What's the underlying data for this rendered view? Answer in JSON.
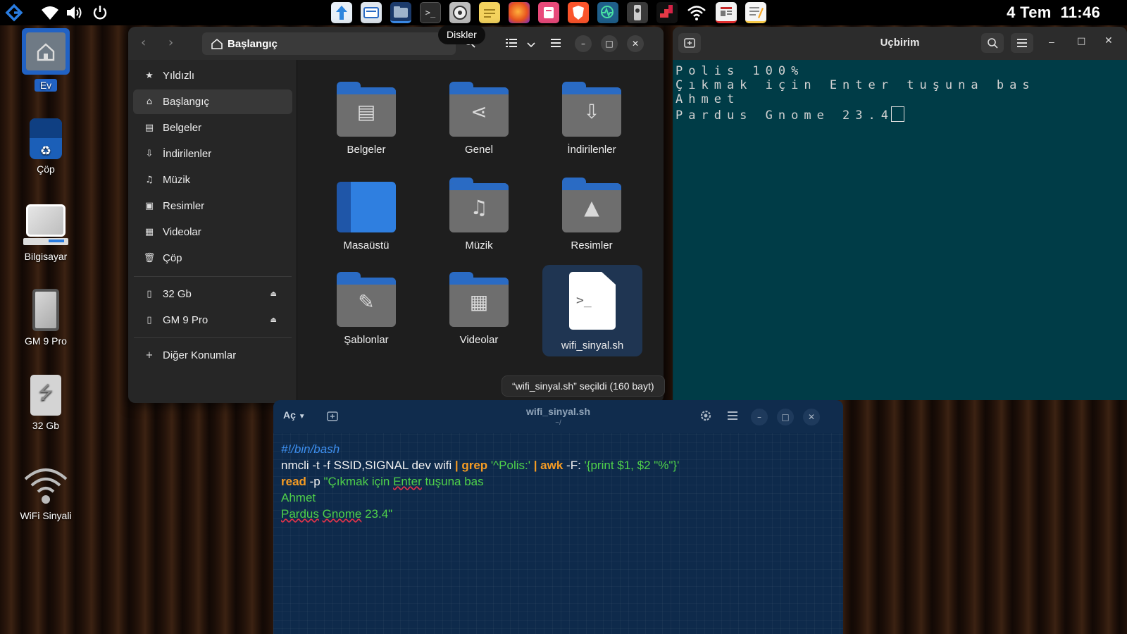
{
  "topbar": {
    "clock_date": "4 Tem",
    "clock_time": "11:46",
    "tooltip": "Diskler",
    "dock_apps": [
      "updater",
      "screenshot",
      "files",
      "terminal",
      "disks",
      "notes",
      "firefox",
      "flashcards",
      "brave",
      "system-monitor",
      "usb-writer",
      "tetris",
      "network",
      "news",
      "text-editor"
    ]
  },
  "desktop": {
    "items": [
      {
        "label": "Ev"
      },
      {
        "label": "Çöp"
      },
      {
        "label": "Bilgisayar"
      },
      {
        "label": "GM 9 Pro"
      },
      {
        "label": "32 Gb"
      },
      {
        "label": "WiFi Sinyali"
      }
    ]
  },
  "file_manager": {
    "path": "Başlangıç",
    "sidebar": [
      {
        "label": "Yıldızlı",
        "icon": "star-icon"
      },
      {
        "label": "Başlangıç",
        "icon": "home-icon"
      },
      {
        "label": "Belgeler",
        "icon": "document-icon"
      },
      {
        "label": "İndirilenler",
        "icon": "download-icon"
      },
      {
        "label": "Müzik",
        "icon": "music-icon"
      },
      {
        "label": "Resimler",
        "icon": "picture-icon"
      },
      {
        "label": "Videolar",
        "icon": "video-icon"
      },
      {
        "label": "Çöp",
        "icon": "trash-icon"
      }
    ],
    "devices": [
      {
        "label": "32 Gb",
        "icon": "usb-drive-icon"
      },
      {
        "label": "GM 9 Pro",
        "icon": "phone-icon"
      }
    ],
    "other_locations": "Diğer Konumlar",
    "items": [
      {
        "label": "Belgeler",
        "icon": "documents-folder-icon"
      },
      {
        "label": "Genel",
        "icon": "share-folder-icon"
      },
      {
        "label": "İndirilenler",
        "icon": "downloads-folder-icon"
      },
      {
        "label": "Masaüstü",
        "icon": "desktop-folder-icon"
      },
      {
        "label": "Müzik",
        "icon": "music-folder-icon"
      },
      {
        "label": "Resimler",
        "icon": "pictures-folder-icon"
      },
      {
        "label": "Şablonlar",
        "icon": "templates-folder-icon"
      },
      {
        "label": "Videolar",
        "icon": "videos-folder-icon"
      },
      {
        "label": "wifi_sinyal.sh",
        "icon": "script-file-icon"
      }
    ],
    "status": "“wifi_sinyal.sh” seçildi  (160 bayt)"
  },
  "terminal": {
    "title": "Uçbirim",
    "lines": [
      "Polis 100%",
      "Çıkmak için Enter tuşuna bas",
      "Ahmet",
      "Pardus Gnome 23.4"
    ]
  },
  "editor": {
    "open_label": "Aç",
    "title": "wifi_sinyal.sh",
    "subtitle": "~/",
    "code": {
      "l1": "#!/bin/bash",
      "l2_cmd": "nmcli -t -f SSID,SIGNAL dev wifi ",
      "l2_pipe1": "| grep",
      "l2_pat": " '^Polis:' ",
      "l2_pipe2": "| awk",
      "l2_f": " -F: ",
      "l2_prog": "'{print $1, $2 \"%\"}'",
      "l3_read": "read",
      "l3_p": " -p ",
      "l3_a": "\"Çıkmak için ",
      "l3_b": "Enter",
      "l3_c": " tuşuna bas",
      "l4": "Ahmet",
      "l5_a": "Pardus",
      "l5_sp": " ",
      "l5_b": "Gnome",
      "l5_c": " 23.4\""
    }
  }
}
